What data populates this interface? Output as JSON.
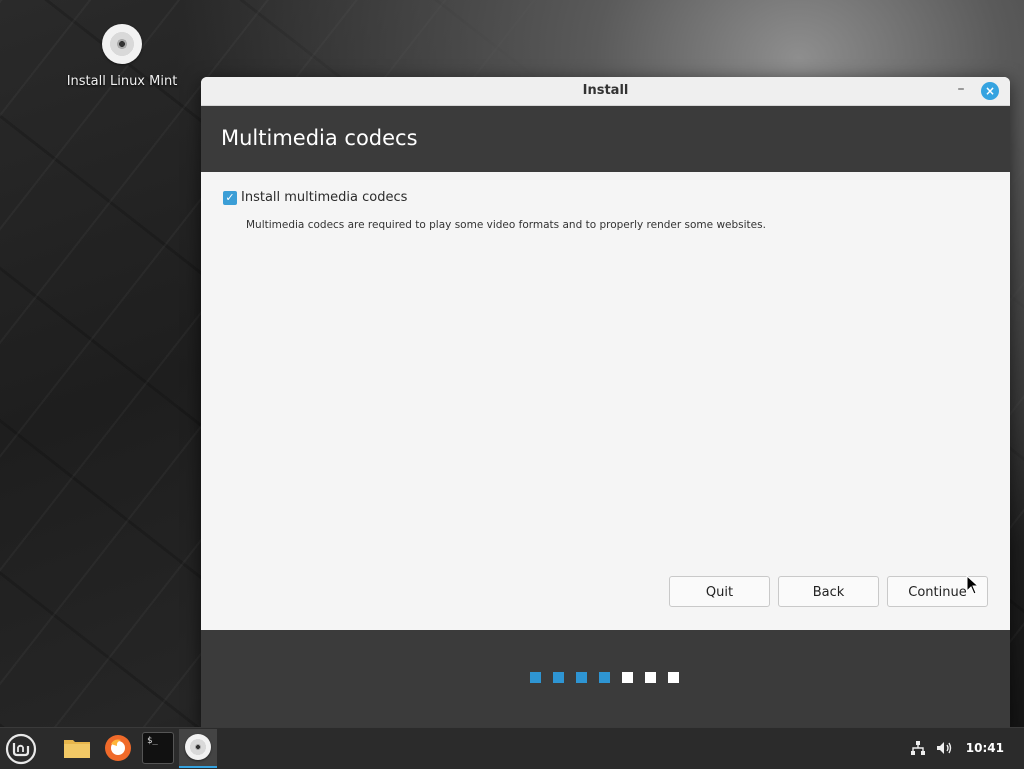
{
  "desktop": {
    "icon_label": "Install Linux Mint",
    "icon_name": "cd-disc-icon"
  },
  "window": {
    "title": "Install",
    "minimize_glyph": "–",
    "close_glyph": "×",
    "header_title": "Multimedia codecs",
    "checkbox": {
      "label": "Install multimedia codecs",
      "checked": true
    },
    "description": "Multimedia codecs are required to play some video formats and to properly render some websites.",
    "buttons": {
      "quit": "Quit",
      "back": "Back",
      "continue": "Continue"
    },
    "progress": {
      "total_steps": 7,
      "completed_steps": 4,
      "active_color": "#2e95d3",
      "inactive_color": "#ffffff"
    }
  },
  "taskbar": {
    "apps": [
      "menu-icon",
      "files-icon",
      "firefox-icon",
      "terminal-icon",
      "installer-icon"
    ],
    "terminal_glyph": "$_",
    "clock": "10:41",
    "accent": "#35a3e0"
  }
}
